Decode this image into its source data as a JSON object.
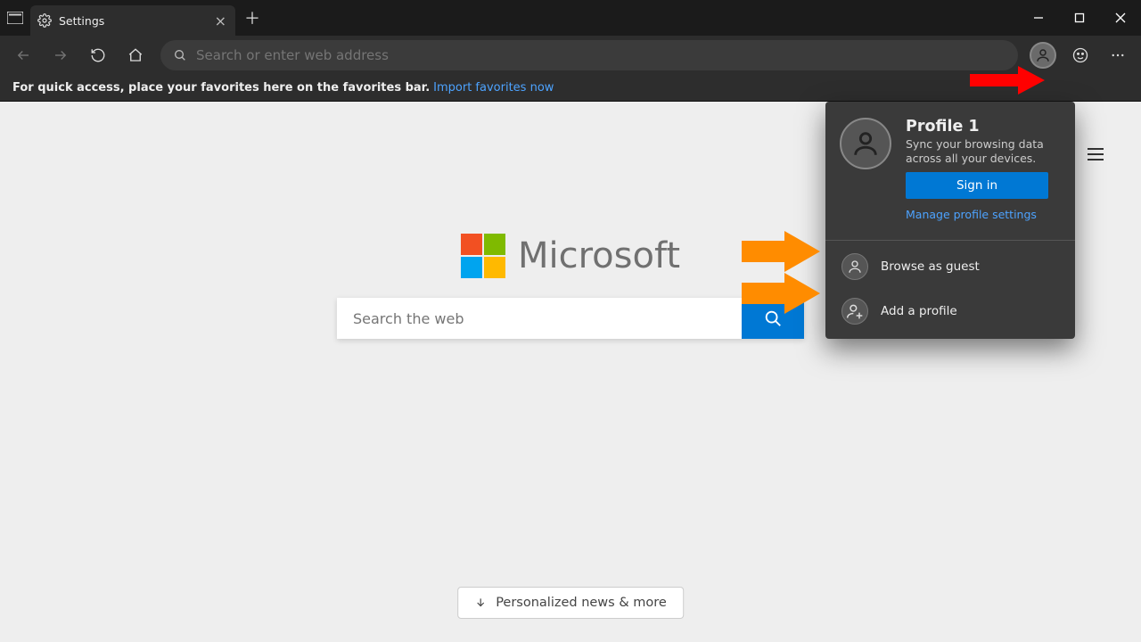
{
  "title_bar": {
    "tab_title": "Settings"
  },
  "tool_bar": {
    "address_placeholder": "Search or enter web address"
  },
  "fav_bar": {
    "hint": "For quick access, place your favorites here on the favorites bar.",
    "import_link": "Import favorites now"
  },
  "content": {
    "brand_word": "Microsoft",
    "search_placeholder": "Search the web",
    "news_button": "Personalized news & more"
  },
  "profile_popup": {
    "name": "Profile 1",
    "desc": "Sync your browsing data across all your devices.",
    "signin": "Sign in",
    "manage": "Manage profile settings",
    "guest": "Browse as guest",
    "add": "Add a profile"
  }
}
